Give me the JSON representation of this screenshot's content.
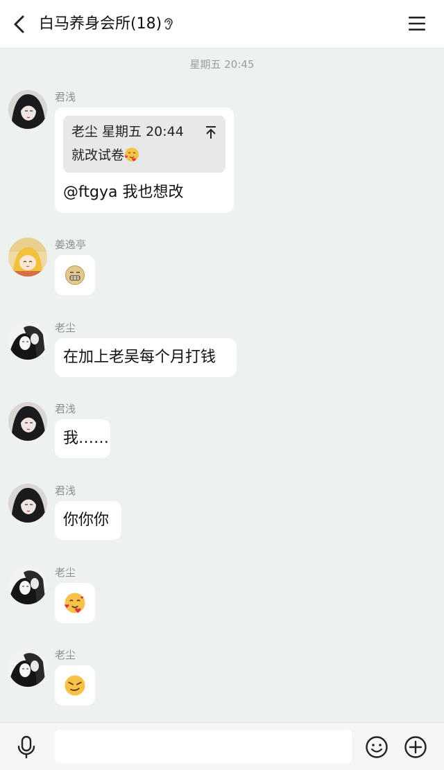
{
  "header": {
    "title": "白马养身会所(18)"
  },
  "timestamp": "星期五 20:45",
  "messages": [
    {
      "sender": "君浅",
      "quote": {
        "author_time": "老尘 星期五 20:44",
        "text": "就改试卷",
        "emoji": "face-with-hearts-emoji"
      },
      "text": "@ftgya 我也想改"
    },
    {
      "sender": "姜逸亭",
      "emoji": "grimacing-face-emoji"
    },
    {
      "sender": "老尘",
      "text": "在加上老吴每个月打钱"
    },
    {
      "sender": "君浅",
      "text": "我……"
    },
    {
      "sender": "君浅",
      "text": "你你你"
    },
    {
      "sender": "老尘",
      "emoji": "face-with-hearts-emoji"
    },
    {
      "sender": "老尘",
      "emoji": "smirking-face-emoji"
    }
  ],
  "input": {
    "value": "",
    "placeholder": ""
  },
  "colors": {
    "background": "#edf2ee",
    "bubble": "#ffffff",
    "quote_bg": "#e8e8e8",
    "meta_text": "#8c8f8d"
  },
  "icons": [
    "back-icon",
    "ear-icon",
    "menu-icon",
    "pin-top-icon",
    "mic-icon",
    "emoji-icon",
    "plus-icon"
  ]
}
